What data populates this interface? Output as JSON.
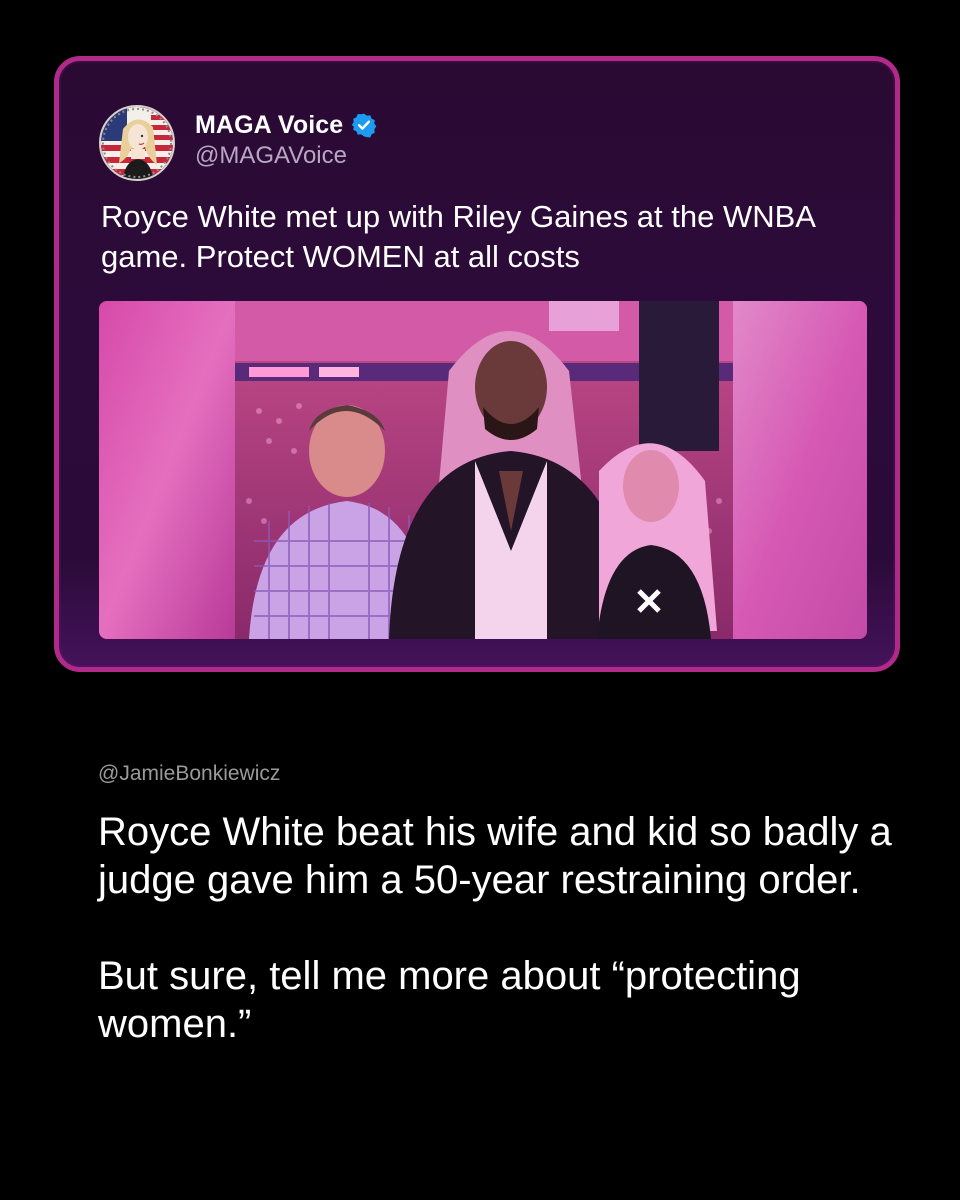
{
  "tweet": {
    "display_name": "MAGA Voice",
    "handle": "@MAGAVoice",
    "verified": true,
    "avatar_icon": "cartoon-avatar-flag-icon",
    "text": "Royce White met up with Riley Gaines at the WNBA game. Protect WOMEN at all costs",
    "media_alt": "photo of three people at arena"
  },
  "response": {
    "handle": "@JamieBonkiewicz",
    "paragraph_1": "Royce White beat his wife and kid so badly a judge gave him a 50-year restraining order.",
    "paragraph_2": "But sure, tell me more about “protecting women.”"
  },
  "colors": {
    "background": "#000000",
    "card_border": "#b02a8a",
    "card_fill": "#2a0a32",
    "verified_badge": "#1d9bf0",
    "handle_gray": "#b9a6c2"
  }
}
